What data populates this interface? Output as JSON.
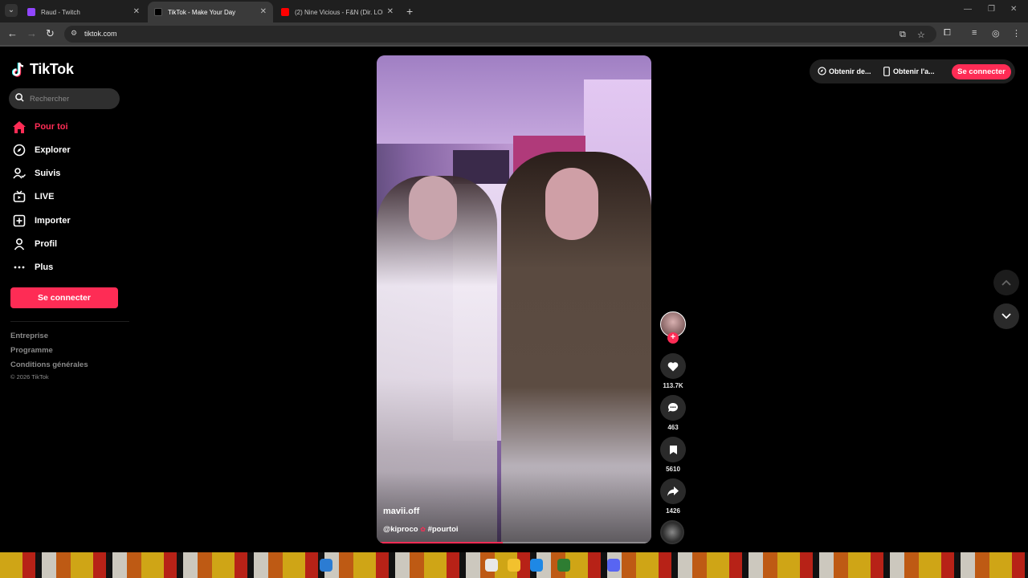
{
  "browser": {
    "tabs": [
      {
        "label": "Raud - Twitch",
        "favicon_color": "#9146ff"
      },
      {
        "label": "TikTok - Make Your Day",
        "favicon_color": "#000000"
      },
      {
        "label": "(2) Nine Vicious - F&N (Dir. LOBO)",
        "favicon_color": "#ff0000"
      }
    ],
    "url": "tiktok.com"
  },
  "sidebar": {
    "logo": "TikTok",
    "search_placeholder": "Rechercher",
    "items": [
      {
        "label": "Pour toi",
        "icon": "home-icon",
        "active": true
      },
      {
        "label": "Explorer",
        "icon": "compass-icon"
      },
      {
        "label": "Suivis",
        "icon": "following-icon"
      },
      {
        "label": "LIVE",
        "icon": "live-icon"
      },
      {
        "label": "Importer",
        "icon": "upload-icon"
      },
      {
        "label": "Profil",
        "icon": "profile-icon"
      },
      {
        "label": "Plus",
        "icon": "more-icon"
      }
    ],
    "login_label": "Se connecter",
    "footer_links": [
      "Entreprise",
      "Programme",
      "Conditions générales"
    ],
    "copyright": "© 2026 TikTok"
  },
  "video": {
    "author": "mavii.off",
    "description_mention": "@kiproco",
    "description_hashtag": "#pourtoi",
    "progress_fraction": 0.46
  },
  "actions": {
    "likes": "113.7K",
    "comments": "463",
    "saves": "5610",
    "shares": "1426"
  },
  "topright": {
    "coins_label": "Obtenir de...",
    "app_label": "Obtenir l'a...",
    "login_label": "Se connecter"
  },
  "colors": {
    "accent": "#fe2c55",
    "background": "#000000"
  }
}
